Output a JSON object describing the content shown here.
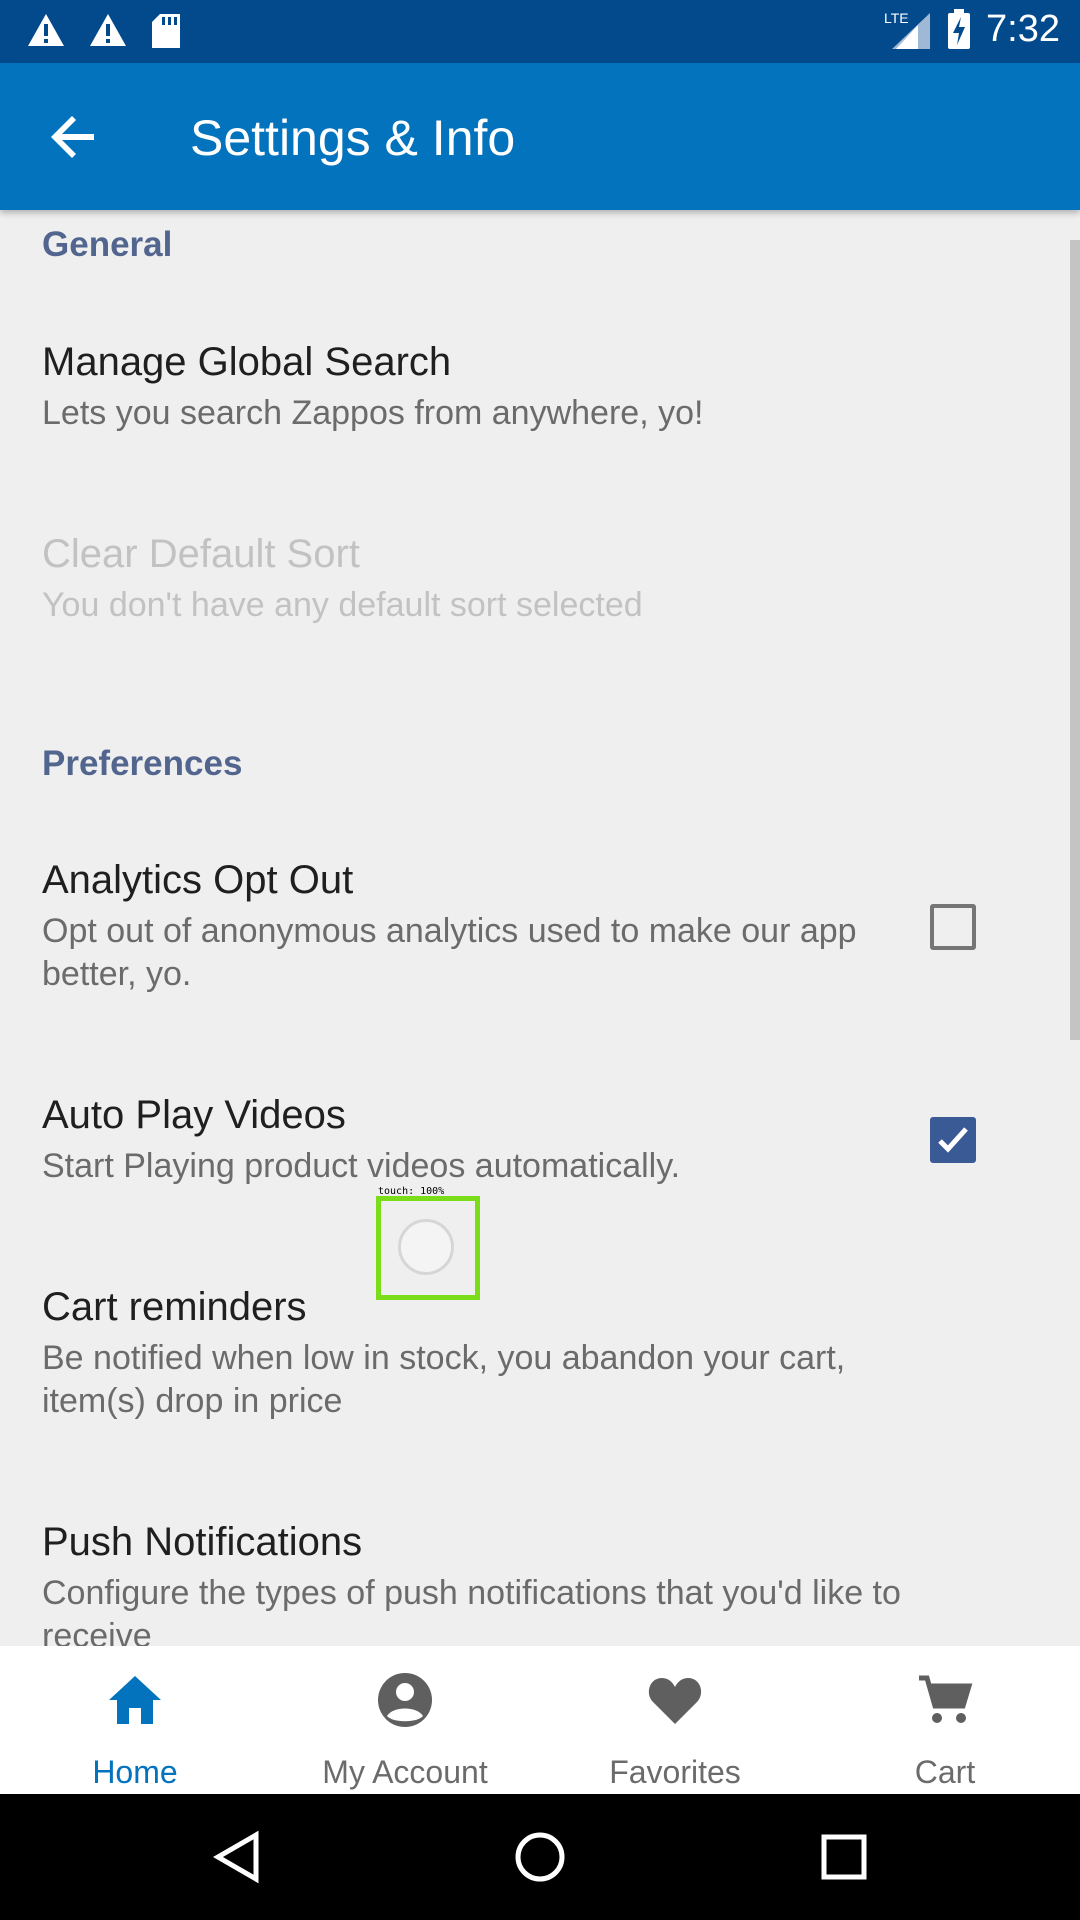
{
  "status_bar": {
    "time": "7:32",
    "network": "LTE",
    "icons": [
      "warning-icon",
      "warning-icon",
      "sd-card-icon",
      "lte-signal-icon",
      "battery-charging-icon"
    ]
  },
  "app_bar": {
    "title": "Settings & Info",
    "back_icon": "back-arrow-icon"
  },
  "sections": {
    "general": "General",
    "preferences": "Preferences"
  },
  "prefs": {
    "manage_search": {
      "title": "Manage Global Search",
      "summary": "Lets you search Zappos from anywhere, yo!"
    },
    "clear_sort": {
      "title": "Clear Default Sort",
      "summary": "You don't have any default sort selected"
    },
    "analytics": {
      "title": "Analytics Opt Out",
      "summary": "Opt out of anonymous analytics used to make our app better, yo.",
      "checked": false
    },
    "autoplay": {
      "title": "Auto Play Videos",
      "summary": "Start Playing product videos automatically.",
      "checked": true
    },
    "cart_reminders": {
      "title": "Cart reminders",
      "summary": "Be notified when low in stock, you abandon your cart, item(s) drop in price"
    },
    "push": {
      "title": "Push Notifications",
      "summary": "Configure the types of push notifications that you'd like to receive"
    }
  },
  "touch_indicator": {
    "label": "touch: 100%"
  },
  "bottom_nav": {
    "items": [
      {
        "label": "Home",
        "icon": "home-icon",
        "active": true
      },
      {
        "label": "My Account",
        "icon": "account-icon",
        "active": false
      },
      {
        "label": "Favorites",
        "icon": "heart-icon",
        "active": false
      },
      {
        "label": "Cart",
        "icon": "cart-icon",
        "active": false
      }
    ]
  },
  "colors": {
    "status_bar": "#024a8c",
    "app_bar": "#0373be",
    "section_header": "#52658f",
    "checkbox_checked": "#3a5a95",
    "nav_active": "#0373be"
  }
}
